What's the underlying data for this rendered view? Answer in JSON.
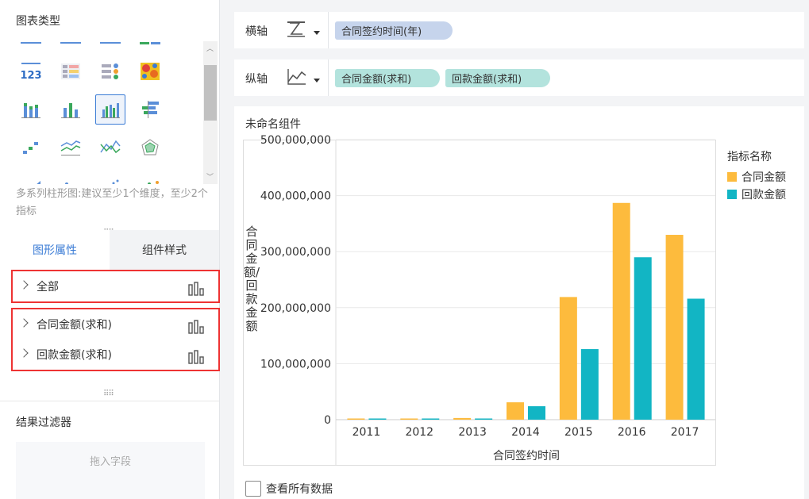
{
  "left_panel": {
    "chart_types_title": "图表类型",
    "chart_hint": "多系列柱形图:建议至少1个维度，至少2个指标",
    "tabs": [
      {
        "label": "图形属性",
        "active": true
      },
      {
        "label": "组件样式",
        "active": false
      }
    ],
    "properties": {
      "all": "全部",
      "items": [
        "合同金额(求和)",
        "回款金额(求和)"
      ]
    },
    "filter_title": "结果过滤器",
    "drop_zone": "拖入字段"
  },
  "x_axis": {
    "label": "横轴",
    "fields": [
      "合同签约时间(年)"
    ]
  },
  "y_axis": {
    "label": "纵轴",
    "fields": [
      "合同金额(求和)",
      "回款金额(求和)"
    ]
  },
  "widget": {
    "title": "未命名组件",
    "view_all_data": "查看所有数据",
    "legend_title": "指标名称"
  },
  "colors": {
    "accent": "#3a7bd5",
    "contract": "#fdbb3d",
    "payment": "#12b5c4",
    "highlight_border": "#ee3333"
  },
  "chart_data": {
    "type": "bar",
    "categories": [
      "2011",
      "2012",
      "2013",
      "2014",
      "2015",
      "2016",
      "2017"
    ],
    "series": [
      {
        "name": "合同金额",
        "values": [
          1000000,
          1000000,
          3000000,
          31000000,
          219000000,
          387000000,
          330000000
        ]
      },
      {
        "name": "回款金额",
        "values": [
          1000000,
          1000000,
          1500000,
          24000000,
          126000000,
          290000000,
          216000000
        ]
      }
    ],
    "y_ticks": [
      "0",
      "100,000,000",
      "200,000,000",
      "300,000,000",
      "400,000,000",
      "500,000,000"
    ],
    "xlabel": "合同签约时间",
    "ylabel": "合同金额/回款金额",
    "ylim": [
      0,
      500000000
    ],
    "grid": true,
    "legend": "right"
  }
}
